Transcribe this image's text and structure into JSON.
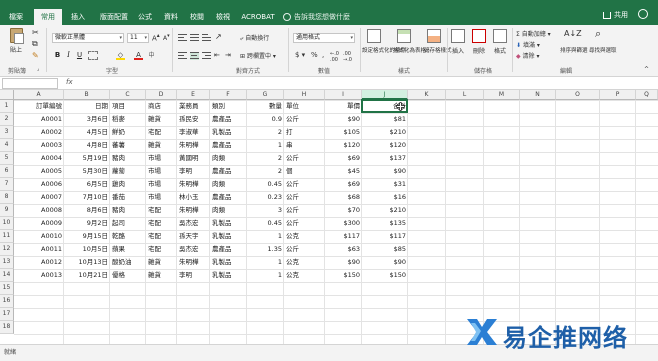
{
  "tabs": [
    {
      "label": "檔案",
      "left": 0
    },
    {
      "label": "常用",
      "active": true
    },
    {
      "label": "插入"
    },
    {
      "label": "版面配置"
    },
    {
      "label": "公式"
    },
    {
      "label": "資料"
    },
    {
      "label": "校閱"
    },
    {
      "label": "檢視"
    },
    {
      "label": "ACROBAT"
    }
  ],
  "tell_me": "告訴我您想做什麼",
  "share": "共用",
  "ribbon": {
    "paste": "貼上",
    "clipboard": "剪貼簿",
    "font": "字型",
    "font_name": "微軟正黑體",
    "font_size": "11",
    "alignment": "對齊方式",
    "wrap_text": "自動換行",
    "merge_center": "跨欄置中",
    "number": "數值",
    "number_format": "通用格式",
    "styles": "樣式",
    "conditional_formatting": "設定格式化的條件",
    "format_as_table": "格式化為表格",
    "cell_styles": "儲存格樣式",
    "cells": "儲存格",
    "insert": "插入",
    "delete": "刪除",
    "format": "格式",
    "editing": "編輯",
    "autosum": "自動加總",
    "fill": "填滿",
    "clear": "清除",
    "sort_filter": "排序與篩選",
    "find_select": "尋找與選取"
  },
  "columns": [
    "A",
    "B",
    "C",
    "D",
    "E",
    "F",
    "G",
    "H",
    "I",
    "J",
    "K",
    "L",
    "M",
    "N",
    "O",
    "P",
    "Q"
  ],
  "rows": [
    "1",
    "2",
    "3",
    "4",
    "5",
    "6",
    "7",
    "8",
    "9",
    "10",
    "11",
    "12",
    "13",
    "14",
    "15",
    "16",
    "17",
    "18"
  ],
  "headers": [
    "訂單編號",
    "日期",
    "項目",
    "商店",
    "業務員",
    "類別",
    "數量",
    "單位",
    "單價",
    "合計"
  ],
  "data": [
    [
      "A0001",
      "3月6日",
      "稻麥",
      "雜貨",
      "孫民安",
      "農產品",
      "0.9",
      "公斤",
      "$90",
      "$81"
    ],
    [
      "A0002",
      "4月5日",
      "鮮奶",
      "宅配",
      "李淑華",
      "乳製品",
      "2",
      "打",
      "$105",
      "$210"
    ],
    [
      "A0003",
      "4月8日",
      "蕃薯",
      "雜貨",
      "朱明樺",
      "農產品",
      "1",
      "串",
      "$120",
      "$120"
    ],
    [
      "A0004",
      "5月19日",
      "豬肉",
      "市場",
      "黃國明",
      "肉類",
      "2",
      "公斤",
      "$69",
      "$137"
    ],
    [
      "A0005",
      "5月30日",
      "蘿蔔",
      "市場",
      "李明",
      "農產品",
      "2",
      "個",
      "$45",
      "$90"
    ],
    [
      "A0006",
      "6月5日",
      "雞肉",
      "市場",
      "朱明樺",
      "肉類",
      "0.45",
      "公斤",
      "$69",
      "$31"
    ],
    [
      "A0007",
      "7月10日",
      "番茄",
      "市場",
      "林小玉",
      "農產品",
      "0.23",
      "公斤",
      "$68",
      "$16"
    ],
    [
      "A0008",
      "8月6日",
      "豬肉",
      "宅配",
      "朱明樺",
      "肉類",
      "3",
      "公斤",
      "$70",
      "$210"
    ],
    [
      "A0009",
      "9月2日",
      "起司",
      "宅配",
      "吳杰宏",
      "乳製品",
      "0.45",
      "公斤",
      "$300",
      "$135"
    ],
    [
      "A0010",
      "9月15日",
      "乾酪",
      "宅配",
      "孫天宇",
      "乳製品",
      "1",
      "公克",
      "$117",
      "$117"
    ],
    [
      "A0011",
      "10月5日",
      "蘋果",
      "宅配",
      "吳杰宏",
      "農產品",
      "1.35",
      "公斤",
      "$63",
      "$85"
    ],
    [
      "A0012",
      "10月13日",
      "酸奶油",
      "雜貨",
      "朱明樺",
      "乳製品",
      "1",
      "公克",
      "$90",
      "$90"
    ],
    [
      "A0013",
      "10月21日",
      "優格",
      "雜貨",
      "李明",
      "乳製品",
      "1",
      "公克",
      "$150",
      "$150"
    ]
  ],
  "status": "就緒",
  "watermark": "易企推网络",
  "colors": {
    "accent": "#217346",
    "watermark": "#1e5fa8"
  }
}
